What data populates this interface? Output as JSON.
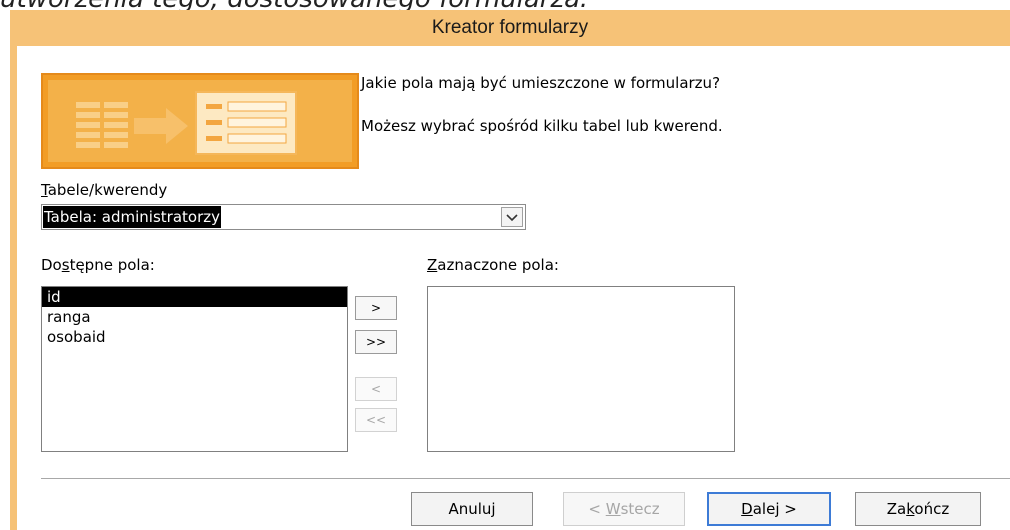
{
  "background_caption": "utworzenia tego, dostosowanego formularza:",
  "window": {
    "title": "Kreator formularzy"
  },
  "header": {
    "question": "Jakie pola mają być umieszczone w formularzu?",
    "hint": "Możesz wybrać spośród kilku tabel lub kwerend."
  },
  "tables": {
    "label_accel": "T",
    "label_rest": "abele/kwerendy",
    "selected": "Tabela: administratorzy",
    "dropdown_icon": "chevron-down-icon"
  },
  "available": {
    "label_pre": "Do",
    "label_accel": "s",
    "label_post": "tępne pola:",
    "items": [
      "id",
      "ranga",
      "osobaid"
    ],
    "selected_index": 0
  },
  "selected_fields": {
    "label_accel": "Z",
    "label_rest": "aznaczone pola:",
    "items": []
  },
  "move_buttons": {
    "add_one": ">",
    "add_all": ">>",
    "remove_one": "<",
    "remove_all": "<<"
  },
  "footer": {
    "cancel": "Anuluj",
    "back_pre": "< ",
    "back_accel": "W",
    "back_post": "stecz",
    "next_accel": "D",
    "next_post": "alej >",
    "finish_pre": "Za",
    "finish_accel": "k",
    "finish_post": "ończ"
  },
  "colors": {
    "frame": "#f6c277",
    "accent_orange": "#f29d26",
    "selection": "#000000",
    "default_button_border": "#3d7bd6"
  }
}
